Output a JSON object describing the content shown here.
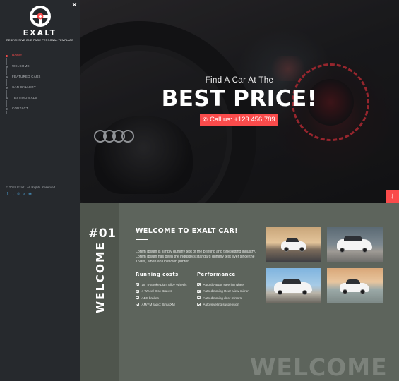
{
  "sidebar": {
    "close_label": "×",
    "brand": "EXALT",
    "tagline": "RESPONSIVE ONE PAGE PERSONAL TEMPLATE",
    "nav": [
      {
        "label": "HOME",
        "active": true
      },
      {
        "label": "WELCOME",
        "active": false
      },
      {
        "label": "FEATURED CARS",
        "active": false
      },
      {
        "label": "CAR GALLERY",
        "active": false
      },
      {
        "label": "TESTIMONIALS",
        "active": false
      },
      {
        "label": "CONTACT",
        "active": false
      }
    ],
    "copyright": "© 2018 Exalt . All Rights Reserved",
    "socials": [
      "facebook-icon",
      "twitter-icon",
      "instagram-icon",
      "skype-icon",
      "dribbble-icon"
    ],
    "social_glyphs": [
      "f",
      "t",
      "◎",
      "s",
      "◉"
    ]
  },
  "hero": {
    "subtitle": "Find A Car At The",
    "title": "BEST PRICE!",
    "cta_label": "Call us: +123 456 789",
    "cta_icon": "phone-icon",
    "scroll_icon": "arrow-down-icon"
  },
  "welcome": {
    "number": "#01",
    "vertical_label": "WELCOME",
    "title": "WELCOME TO EXALT CAR!",
    "text": "Lorem Ipsum is simply dummy text of the printing and typesetting industry. Lorem Ipsum has been the industry's standard dummy text ever since the 1500s, when an unknown printer.",
    "running_costs": {
      "title": "Running costs",
      "items": [
        "18\" 5-Spoke Light Alloy Wheels",
        "4-Wheel Disc Brakes",
        "ABS brakes",
        "AM/FM radio: SiriusXM"
      ]
    },
    "performance": {
      "title": "Performance",
      "items": [
        "Auto tilt-away steering wheel",
        "Auto-dimming Rear-View mirror",
        "Auto-dimming door mirrors",
        "Auto-leveling suspension"
      ]
    },
    "background_word": "WELCOME"
  },
  "colors": {
    "accent": "#fa4b4b",
    "sidebar_bg": "#26292d",
    "section_bg": "#5d645c"
  }
}
